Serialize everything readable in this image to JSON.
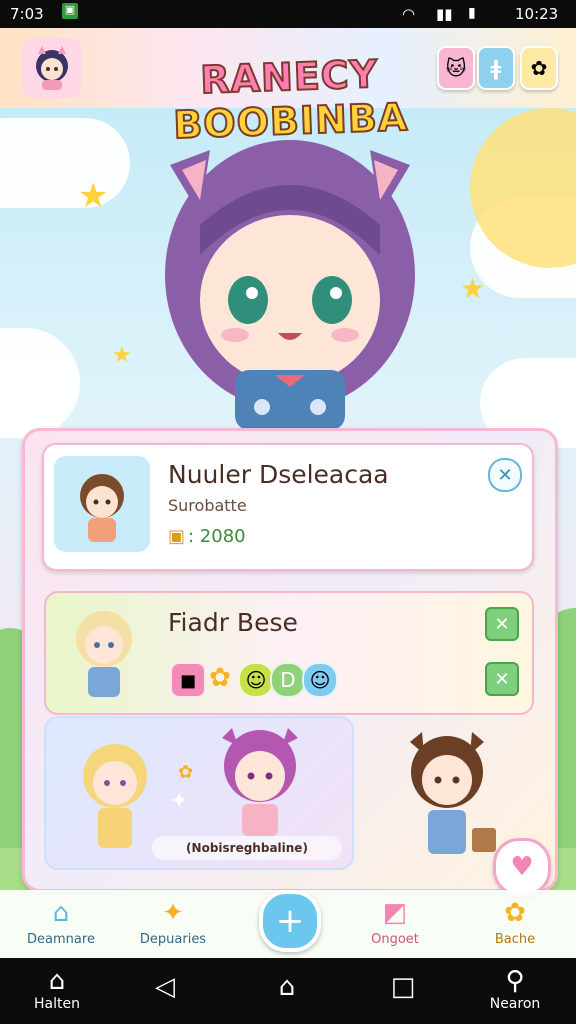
{
  "status_bar": {
    "time": "7:03",
    "clock": "10:23"
  },
  "app": {
    "title_part1": "RANECY",
    "title_part2": "BOOBINBA"
  },
  "cards": {
    "player": {
      "name": "Nuuler Dseleacaa",
      "subtitle": "Surobatte",
      "score": ": 2080"
    },
    "friend": {
      "name": "Fiadr Bese"
    },
    "banner_label": "(Nobisreghbaline)"
  },
  "bottom_nav": {
    "items": [
      {
        "label": "Deamnare"
      },
      {
        "label": "Depuaries"
      },
      {
        "label": "Ongoet"
      },
      {
        "label": "Bache"
      }
    ]
  },
  "system_nav": {
    "home_label": "Halten",
    "search_label": "Nearon"
  },
  "colors": {
    "accent_pink": "#f285b2",
    "accent_blue": "#6cc7ee",
    "accent_green": "#7ed07e",
    "title_yellow": "#ffd23a"
  }
}
